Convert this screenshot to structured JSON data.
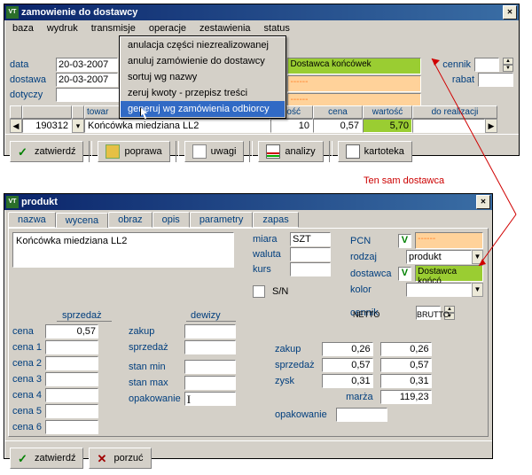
{
  "win1": {
    "title": "zamowienie do dostawcy",
    "menubar": [
      "baza",
      "wydruk",
      "transmisje",
      "operacje",
      "zestawienia",
      "status"
    ],
    "dropdown": {
      "items": [
        "anulacja części niezrealizowanej",
        "anuluj zamówienie do dostawcy",
        "sortuj wg nazwy",
        "zeruj kwoty - przepisz treści",
        "generuj wg zamówienia odbiorcy"
      ],
      "selected_index": 4
    },
    "left_labels": {
      "data": "data",
      "dostawa": "dostawa",
      "dotyczy": "dotyczy"
    },
    "data_value": "20-03-2007",
    "dostawa_value": "20-03-2007",
    "dotyczy_value": "",
    "supplier_rows": [
      {
        "text": "Dostawca końcówek",
        "hl": true
      },
      {
        "text": "------",
        "hl": false
      },
      {
        "text": "------",
        "hl": false
      }
    ],
    "right_labels": {
      "cennik": "cennik",
      "rabat": "rabat"
    },
    "table": {
      "headers": {
        "towar": "towar",
        "ilosc": "ilość",
        "cena": "cena",
        "wartosc": "wartość",
        "real": "do realizacji"
      },
      "row": {
        "code": "190312",
        "name": "Końcówka miedziana LL2",
        "ilosc": "10",
        "cena": "0,57",
        "wartosc": "5,70",
        "real": ""
      }
    },
    "buttons": {
      "zatwierdz": "zatwierdź",
      "poprawa": "poprawa",
      "uwagi": "uwagi",
      "analizy": "analizy",
      "kartoteka": "kartoteka"
    }
  },
  "annotation": "Ten sam dostawca",
  "win2": {
    "title": "produkt",
    "tabs": [
      "nazwa",
      "wycena",
      "obraz",
      "opis",
      "parametry",
      "zapas"
    ],
    "active_tab_index": 1,
    "product_name": "Końcówka miedziana LL2",
    "mid_labels": {
      "miara": "miara",
      "waluta": "waluta",
      "kurs": "kurs",
      "sn": "S/N"
    },
    "miara_value": "SZT",
    "right_labels": {
      "pcn": "PCN",
      "rodzaj": "rodzaj",
      "dostawca": "dostawca",
      "kolor": "kolor",
      "cennik": "cennik"
    },
    "pcn_value": "------",
    "rodzaj_value": "produkt",
    "dostawca_value": "Dostawca końcó",
    "section_labels": {
      "sprzedaz": "sprzedaż",
      "dewizy": "dewizy",
      "netto": "NETTO",
      "brutto": "BRUTTO"
    },
    "price_rows": {
      "cena": "cena",
      "cena1": "cena 1",
      "cena2": "cena 2",
      "cena3": "cena 3",
      "cena4": "cena 4",
      "cena5": "cena 5",
      "cena6": "cena 6"
    },
    "price_values": {
      "cena": "0,57"
    },
    "mid_rows": {
      "zakup": "zakup",
      "sprzedaz": "sprzedaż",
      "stanmin": "stan min",
      "stanmax": "stan max",
      "opakowanie": "opakowanie"
    },
    "calc_rows": {
      "zakup": "zakup",
      "sprzedaz": "sprzedaż",
      "zysk": "zysk",
      "marza": "marża",
      "opakowanie": "opakowanie"
    },
    "calc_values": {
      "zakup_n": "0,26",
      "zakup_b": "0,26",
      "sprzedaz_n": "0,57",
      "sprzedaz_b": "0,57",
      "zysk_n": "0,31",
      "zysk_b": "0,31",
      "marza": "119,23"
    },
    "buttons": {
      "zatwierdz": "zatwierdź",
      "porzuc": "porzuć"
    }
  }
}
